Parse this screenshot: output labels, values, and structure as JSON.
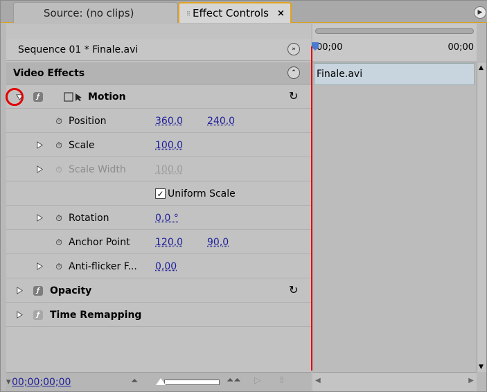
{
  "tabs": {
    "source": "Source: (no clips)",
    "effect_controls": "Effect Controls",
    "close_glyph": "×"
  },
  "header": {
    "sequence_label": "Sequence 01 * Finale.avi",
    "video_effects": "Video Effects"
  },
  "motion": {
    "label": "Motion",
    "properties": {
      "position": {
        "label": "Position",
        "x": "360,0",
        "y": "240,0"
      },
      "scale": {
        "label": "Scale",
        "value": "100,0"
      },
      "scale_width": {
        "label": "Scale Width",
        "value": "100,0"
      },
      "uniform_scale": {
        "label": "Uniform Scale",
        "checked": true
      },
      "rotation": {
        "label": "Rotation",
        "value": "0,0 °"
      },
      "anchor_point": {
        "label": "Anchor Point",
        "x": "120,0",
        "y": "90,0"
      },
      "anti_flicker": {
        "label": "Anti-flicker F...",
        "value": "0,00"
      }
    }
  },
  "opacity": {
    "label": "Opacity"
  },
  "time_remapping": {
    "label": "Time Remapping"
  },
  "timeline": {
    "time_start": "00;00",
    "time_end": "00;00",
    "clip_name": "Finale.avi"
  },
  "bottom": {
    "timecode": "00;00;00;00"
  },
  "colors": {
    "accent_orange": "#e0a21e",
    "playhead_red": "#e20000",
    "value_blue": "#1d1d9a",
    "clip_fill": "#c9d5de"
  }
}
